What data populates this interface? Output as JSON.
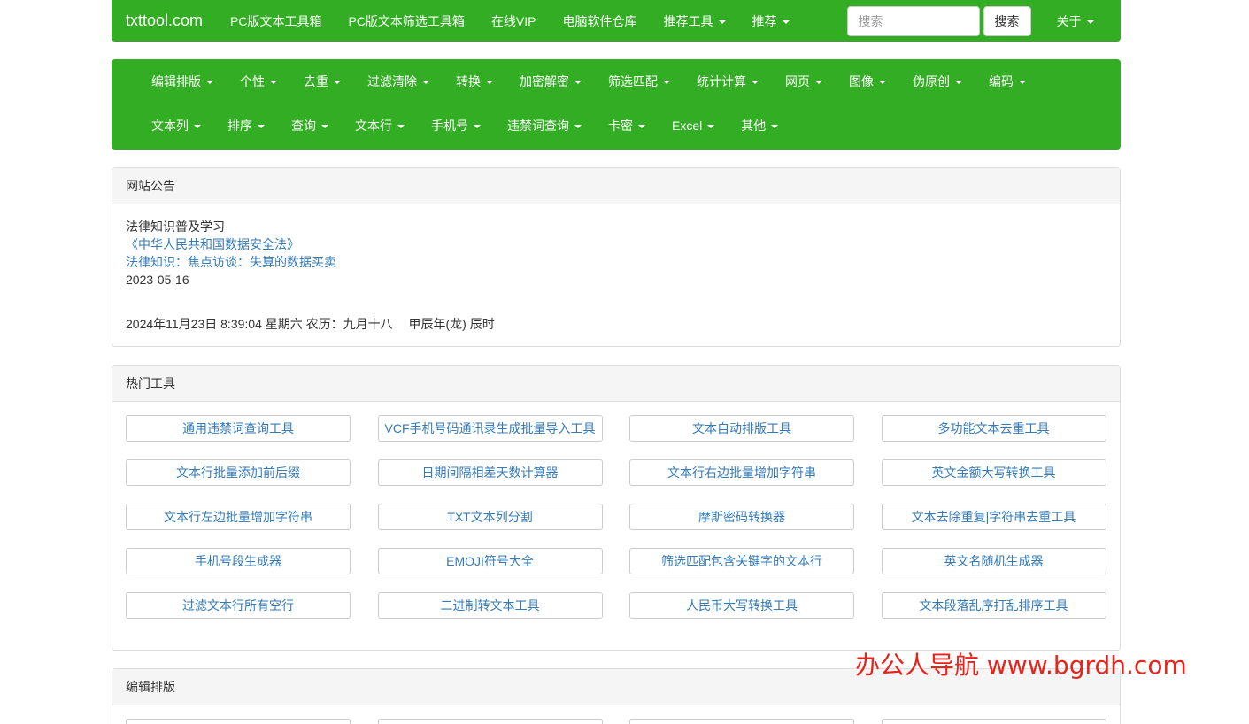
{
  "topnav": {
    "brand": "txttool.com",
    "links": [
      "PC版文本工具箱",
      "PC版文本筛选工具箱",
      "在线VIP",
      "电脑软件仓库"
    ],
    "dropdowns": [
      "推荐工具",
      "推荐"
    ],
    "search_placeholder": "搜索",
    "search_button": "搜索",
    "about": "关于"
  },
  "catnav": {
    "row1": [
      "编辑排版",
      "个性",
      "去重",
      "过滤清除",
      "转换",
      "加密解密",
      "筛选匹配",
      "统计计算",
      "网页",
      "图像",
      "伪原创",
      "编码"
    ],
    "row2": [
      "文本列",
      "排序",
      "查询",
      "文本行",
      "手机号",
      "违禁词查询",
      "卡密",
      "Excel",
      "其他"
    ]
  },
  "notice": {
    "title": "网站公告",
    "line1": "法律知识普及学习",
    "link1": "《中华人民共和国数据安全法》",
    "link2": "法律知识：焦点访谈：失算的数据买卖",
    "date": "2023-05-16",
    "datetime": "2024年11月23日 8:39:04 星期六 农历：九月十八　 甲辰年(龙) 辰时"
  },
  "hot": {
    "title": "热门工具",
    "tools": [
      "通用违禁词查询工具",
      "VCF手机号码通讯录生成批量导入工具",
      "文本自动排版工具",
      "多功能文本去重工具",
      "文本行批量添加前后缀",
      "日期间隔相差天数计算器",
      "文本行右边批量增加字符串",
      "英文金额大写转换工具",
      "文本行左边批量增加字符串",
      "TXT文本列分割",
      "摩斯密码转换器",
      "文本去除重复|字符串去重工具",
      "手机号段生成器",
      "EMOJI符号大全",
      "筛选匹配包含关键字的文本行",
      "英文名随机生成器",
      "过滤文本行所有空行",
      "二进制转文本工具",
      "人民币大写转换工具",
      "文本段落乱序打乱排序工具"
    ]
  },
  "edit": {
    "title": "编辑排版"
  },
  "watermark": "办公人导航 www.bgrdh.com"
}
